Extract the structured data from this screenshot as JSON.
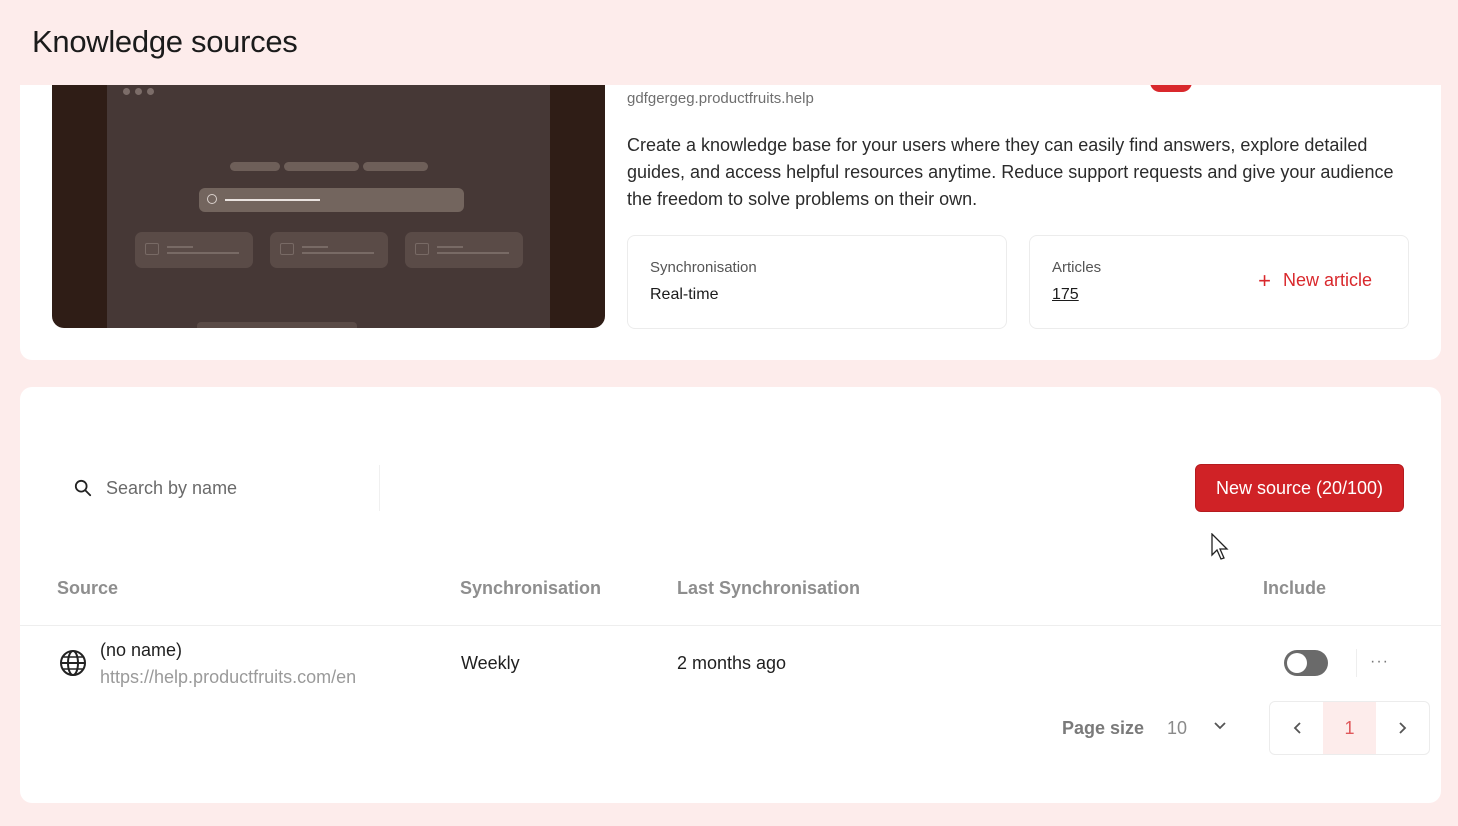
{
  "header": {
    "title": "Knowledge sources"
  },
  "knowledge_base": {
    "url": "gdfgergeg.productfruits.help",
    "description": "Create a knowledge base for your users where they can easily find answers, explore detailed guides, and access helpful resources anytime. Reduce support requests and give your audience the freedom to solve problems on their own.",
    "sync_label": "Synchronisation",
    "sync_value": "Real-time",
    "articles_label": "Articles",
    "articles_value": "175",
    "new_article_label": "New article",
    "toggle_color": "#d9282c"
  },
  "sources": {
    "search_placeholder": "Search by name",
    "new_source_label": "New source (20/100)",
    "columns": {
      "source": "Source",
      "synchronisation": "Synchronisation",
      "last_synchronisation": "Last Synchronisation",
      "include": "Include"
    },
    "rows": [
      {
        "icon": "globe-icon",
        "name": "(no name)",
        "url": "https://help.productfruits.com/en",
        "synchronisation": "Weekly",
        "last_synchronisation": "2 months ago",
        "include": false
      }
    ],
    "more_label": "···",
    "page_size_label": "Page size",
    "page_size_value": "10",
    "current_page": "1"
  },
  "colors": {
    "accent": "#d02226",
    "background": "#fdeceb",
    "toggle_off": "#6a6a6a"
  }
}
